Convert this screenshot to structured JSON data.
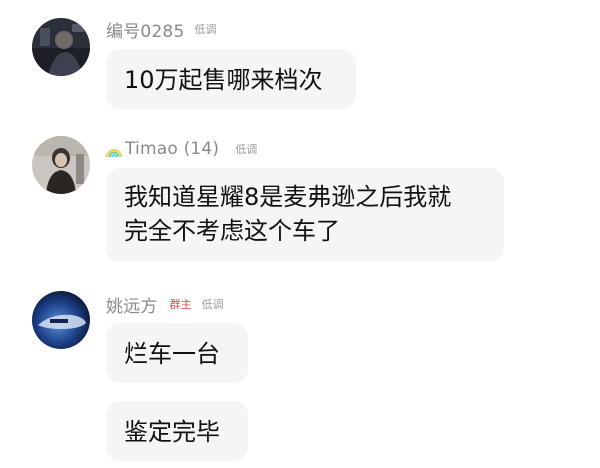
{
  "messages": [
    {
      "sender": "编号0285",
      "tag": "低调",
      "bubbles": [
        "10万起售哪来档次"
      ]
    },
    {
      "sender": "Timao (14)",
      "sender_icon": "rainbow-icon",
      "tag": "低调",
      "bubbles": [
        "我知道星耀8是麦弗逊之后我就",
        "完全不考虑这个车了"
      ]
    },
    {
      "sender": "姚远方",
      "owner_tag": "群主",
      "tag": "低调",
      "bubbles": [
        "烂车一台",
        "鉴定完毕"
      ]
    }
  ],
  "colors": {
    "owner_tag": "#e0474c",
    "bubble_bg": "#f5f5f5",
    "name_text": "#8a8a8a"
  }
}
